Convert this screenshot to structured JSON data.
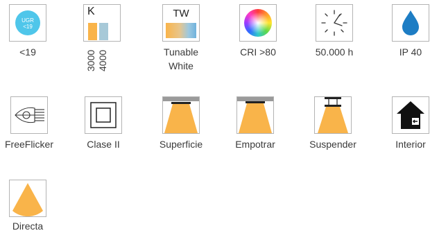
{
  "row1": {
    "ugr": {
      "badge_top": "UGR",
      "badge_bottom": "<19",
      "caption": "<19"
    },
    "kelvin": {
      "letter": "K",
      "val1": "3000",
      "val2": "4000"
    },
    "tunable": {
      "letter": "TW",
      "caption_line1": "Tunable",
      "caption_line2": "White"
    },
    "cri": {
      "caption": "CRI >80"
    },
    "hours": {
      "caption": "50.000 h"
    },
    "ip": {
      "caption": "IP 40"
    }
  },
  "row2": {
    "freeflicker": {
      "caption": "FreeFlicker"
    },
    "clase": {
      "caption": "Clase II"
    },
    "superficie": {
      "caption": "Superficie"
    },
    "empotrar": {
      "caption": "Empotrar"
    },
    "suspender": {
      "caption": "Suspender"
    },
    "interior": {
      "caption": "Interior"
    }
  },
  "row3": {
    "directa": {
      "caption": "Directa"
    }
  },
  "colors": {
    "orange": "#f9b44a",
    "ugr_blue": "#4fc6ea",
    "drop_blue": "#1d7dc4",
    "k_blue": "#a7c9d8",
    "border": "#b3b3b3"
  }
}
